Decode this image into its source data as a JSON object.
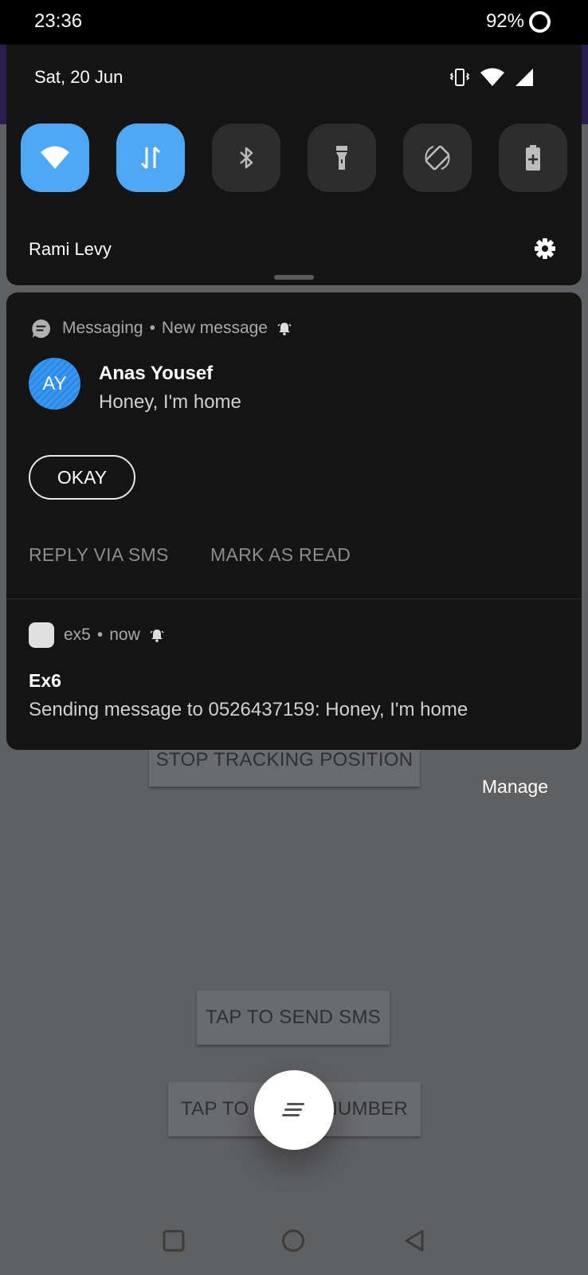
{
  "status_bar": {
    "time": "23:36",
    "battery": "92%"
  },
  "quick_settings": {
    "date": "Sat, 20 Jun",
    "user": "Rami Levy",
    "tiles": [
      {
        "name": "wifi",
        "active": true
      },
      {
        "name": "mobile-data",
        "active": true
      },
      {
        "name": "bluetooth",
        "active": false
      },
      {
        "name": "flashlight",
        "active": false
      },
      {
        "name": "auto-rotate",
        "active": false
      },
      {
        "name": "battery-saver",
        "active": false
      }
    ],
    "accent_color": "#4fa8f5"
  },
  "notification_messaging": {
    "app": "Messaging",
    "subtext": "New message",
    "avatar_initials": "AY",
    "sender": "Anas Yousef",
    "message": "Honey, I'm home",
    "reply_button": "OKAY",
    "actions": [
      "REPLY VIA SMS",
      "MARK AS READ"
    ]
  },
  "notification_ex5": {
    "app": "ex5",
    "time": "now",
    "title": "Ex6",
    "text": "Sending message to 0526437159: Honey, I'm home"
  },
  "manage_label": "Manage",
  "background_app": {
    "stop_tracking": "STOP TRACKING POSITION",
    "send_sms": "TAP TO SEND SMS",
    "number_button_left": "TAP TO",
    "number_button_right": "NUMBER"
  }
}
